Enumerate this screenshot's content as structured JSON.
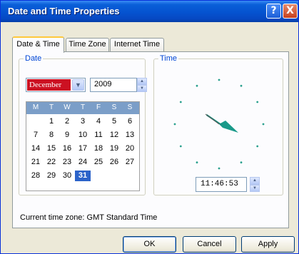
{
  "window": {
    "title": "Date and Time Properties",
    "help_label": "?",
    "close_label": "X"
  },
  "tabs": [
    {
      "label": "Date & Time",
      "active": true
    },
    {
      "label": "Time Zone",
      "active": false
    },
    {
      "label": "Internet Time",
      "active": false
    }
  ],
  "date_group": {
    "label": "Date",
    "month": "December",
    "year": "2009",
    "weekday_headers": [
      "M",
      "T",
      "W",
      "T",
      "F",
      "S",
      "S"
    ],
    "weeks": [
      [
        "",
        "1",
        "2",
        "3",
        "4",
        "5",
        "6"
      ],
      [
        "7",
        "8",
        "9",
        "10",
        "11",
        "12",
        "13"
      ],
      [
        "14",
        "15",
        "16",
        "17",
        "18",
        "19",
        "20"
      ],
      [
        "21",
        "22",
        "23",
        "24",
        "25",
        "26",
        "27"
      ],
      [
        "28",
        "29",
        "30",
        "31",
        "",
        "",
        ""
      ]
    ],
    "selected_day": "31"
  },
  "time_group": {
    "label": "Time",
    "time_value": "11:46:53"
  },
  "timezone_text": "Current time zone:  GMT Standard Time",
  "buttons": {
    "ok": "OK",
    "cancel": "Cancel",
    "apply": "Apply"
  },
  "icons": {
    "dropdown": "chevron-down-icon",
    "spin_up": "triangle-up-icon",
    "spin_down": "triangle-down-icon"
  },
  "colors": {
    "title_bar": "#0553d0",
    "month_highlight": "#cc1122",
    "calendar_header": "#7b9ec8",
    "selected_day": "#2c63c9",
    "clock_hands": "#1a9a8a",
    "group_label": "#0046d5"
  }
}
